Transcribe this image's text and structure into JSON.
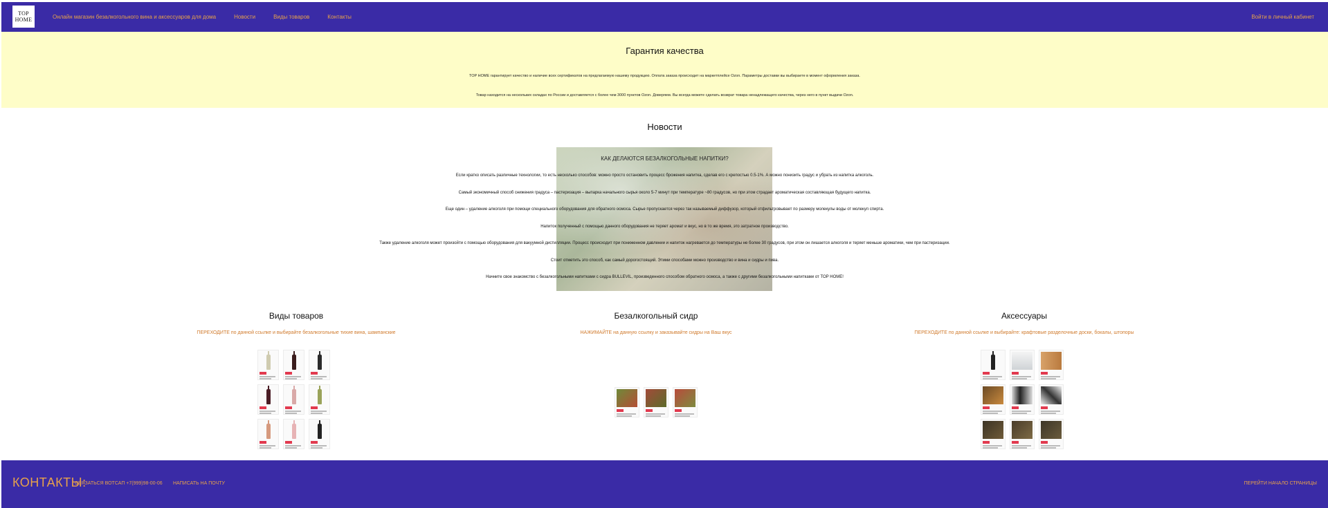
{
  "header": {
    "logo_line1": "TOP",
    "logo_line2": "HOME",
    "nav": [
      "Онлайн магазин безалкогольного вина и аксессуаров для дома",
      "Новости",
      "Виды товаров",
      "Контакты"
    ],
    "cabinet": "Войти в личный кабинет"
  },
  "quality": {
    "title": "Гарантия качества",
    "text1": "TOP HOME гарантирует качество и наличие всех сертификатов на предлагаемую нашему продукцию. Оплата заказа происходит на маркетплейсе Ozon. Параметры доставки вы выбираете в момент оформления заказа.",
    "text2": "Товар находится на нескольких складах по России и доставляется с более чем 3000 пунктов Ozon. Доверяем. Вы всегда можете сделать возврат товара ненадлежащего качества, через него в пункт выдачи Ozon."
  },
  "news": {
    "title": "Новости",
    "headline": "КАК ДЕЛАЮТСЯ БЕЗАЛКОГОЛЬНЫЕ НАПИТКИ?",
    "paragraphs": [
      "Если кратко описать различные технологии, то есть несколько способов: можно просто остановить процесс брожения напитка, сделав его с крепостью 0.5-1%. А можно понизить градус и убрать из напитка алкоголь.",
      "Самый экономичный способ снижения градуса – пастеризация – выпарка начального сырья около 5-7 минут при температуре ~80 градусов, но при этом страдает ароматическая составляющая будущего напитка.",
      "Еще один – удаление алкоголя при помощи специального оборудования для обратного осмоса. Сырье пропускается через так называемый диффузор, который отфильтровывает по размеру молекулы воды от молекул спирта.",
      "Напиток полученный с помощью данного оборудования не теряет аромат и вкус, но в то же время, это затратное производство.",
      "Также удаление алкоголя может произойти с помощью оборудования для вакуумной дистилляции. Процесс происходит при пониженном давлении и напиток нагревается до температуры не более 30 градусов, при этом он лишается алкоголя и теряет меньше ароматики, чем при пастеризации.",
      "Стоит отметить это способ, как самый дорогостоящий. Этими способами можно производство и вина и сидры и пива.",
      "Начните свое знакомство с безалкогольными напитками с сидра BULLEVIL, произведенного способом обратного осмоса, а также с другими безалкогольными напитками от TOP HOME!"
    ]
  },
  "categories": [
    {
      "title": "Виды товаров",
      "link": "ПЕРЕХОДИТЕ по данной ссылке и выбирайте безалкогольные тихие вина, шампанские"
    },
    {
      "title": "Безалкогольный сидр",
      "link": "НАЖИМАЙТЕ на данную ссылку и заказывайте сидры на Ваш вкус"
    },
    {
      "title": "Аксессуары",
      "link": "ПЕРЕХОДИТЕ по данной ссылке и выбирайте: крафтовые разделочные доски, бокалы, штопоры"
    }
  ],
  "footer": {
    "contacts": "КОНТАКТЫ:",
    "whatsapp": "СВЯЗАТЬСЯ ВОТСАП +7(999)98-00-06",
    "email": "НАПИСАТЬ НА ПОЧТУ",
    "top": "ПЕРЕЙТИ НАЧАЛО СТРАНИЦЫ"
  },
  "colors": {
    "header_bg": "#3a2ba6",
    "accent": "#e8a24a",
    "quality_bg": "#fefdc8",
    "link": "#d07a2c"
  }
}
